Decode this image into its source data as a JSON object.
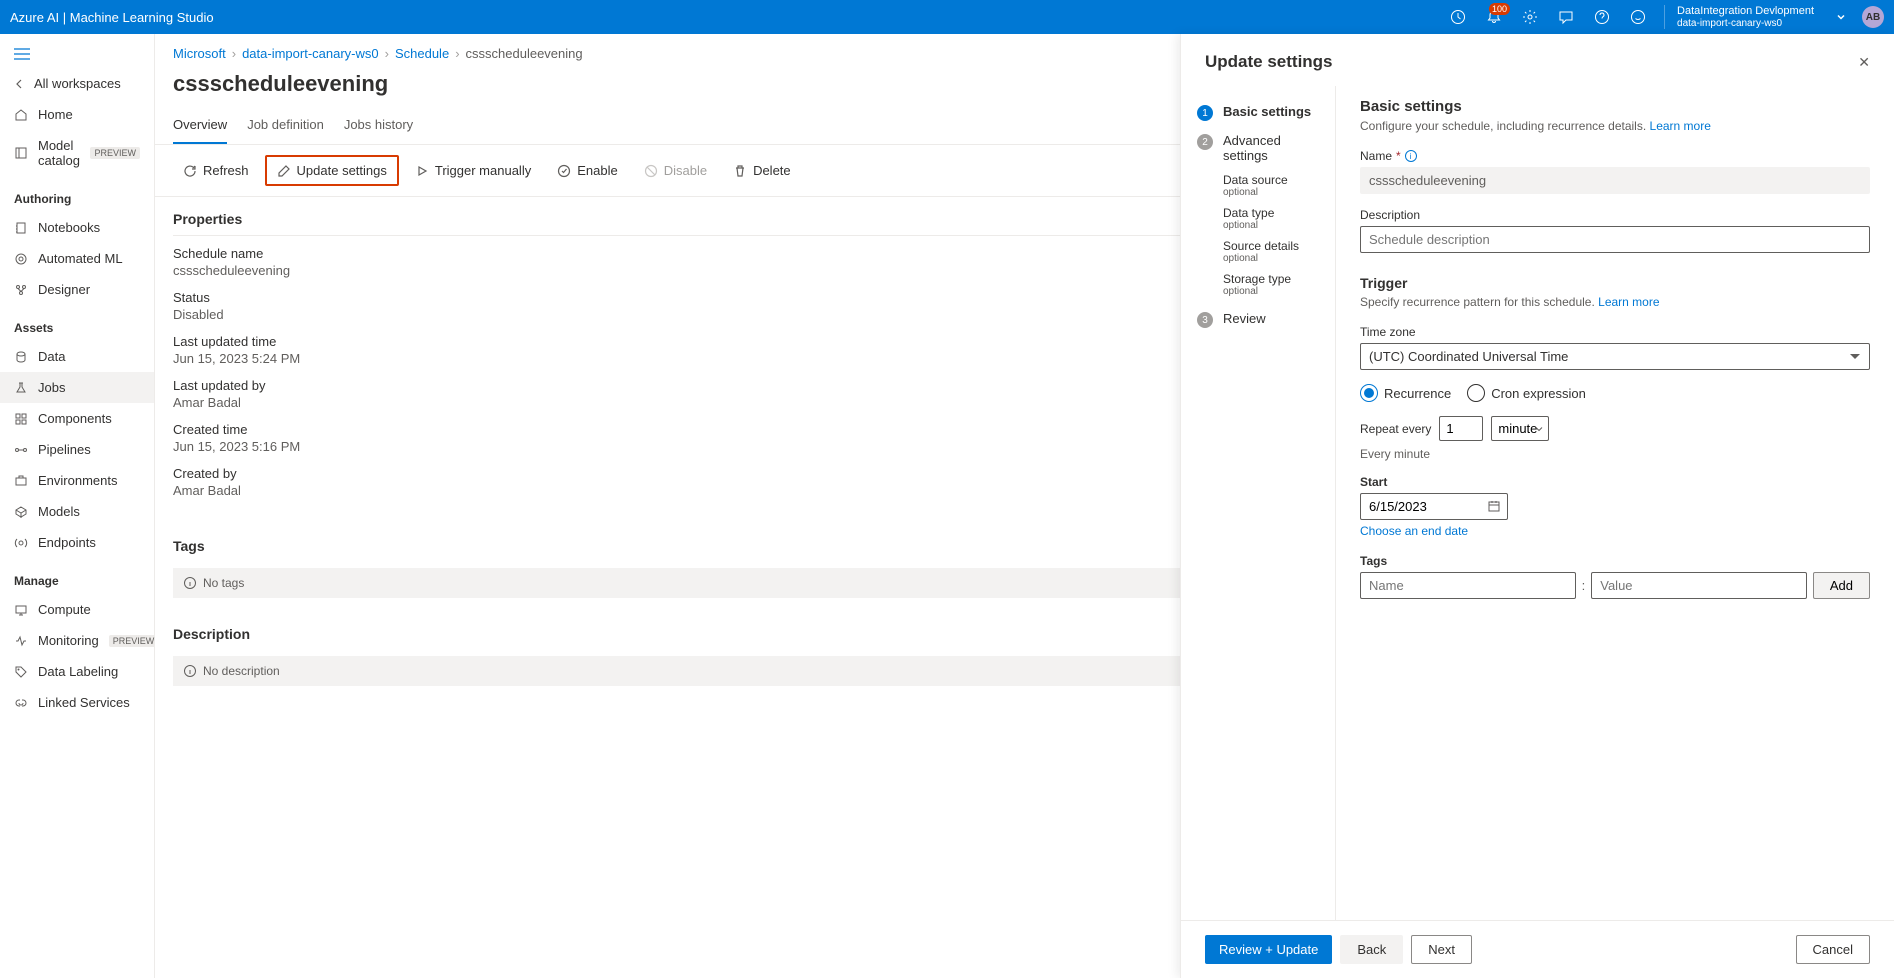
{
  "header": {
    "title": "Azure AI | Machine Learning Studio",
    "notification_count": "100",
    "account_name": "DataIntegration Devlopment",
    "account_ws": "data-import-canary-ws0",
    "avatar_initials": "AB"
  },
  "nav": {
    "back": "All workspaces",
    "items_top": [
      {
        "label": "Home",
        "icon": "home"
      },
      {
        "label": "Model catalog",
        "icon": "catalog",
        "preview": "PREVIEW"
      }
    ],
    "group_authoring": "Authoring",
    "items_authoring": [
      {
        "label": "Notebooks",
        "icon": "notebook"
      },
      {
        "label": "Automated ML",
        "icon": "automl"
      },
      {
        "label": "Designer",
        "icon": "designer"
      }
    ],
    "group_assets": "Assets",
    "items_assets": [
      {
        "label": "Data",
        "icon": "data"
      },
      {
        "label": "Jobs",
        "icon": "jobs",
        "active": true
      },
      {
        "label": "Components",
        "icon": "components"
      },
      {
        "label": "Pipelines",
        "icon": "pipelines"
      },
      {
        "label": "Environments",
        "icon": "environments"
      },
      {
        "label": "Models",
        "icon": "models"
      },
      {
        "label": "Endpoints",
        "icon": "endpoints"
      }
    ],
    "group_manage": "Manage",
    "items_manage": [
      {
        "label": "Compute",
        "icon": "compute"
      },
      {
        "label": "Monitoring",
        "icon": "monitoring",
        "preview": "PREVIEW"
      },
      {
        "label": "Data Labeling",
        "icon": "labeling"
      },
      {
        "label": "Linked Services",
        "icon": "linked"
      }
    ]
  },
  "breadcrumb": {
    "items": [
      "Microsoft",
      "data-import-canary-ws0",
      "Schedule",
      "cssscheduleevening"
    ]
  },
  "page": {
    "title": "cssscheduleevening",
    "tabs": [
      "Overview",
      "Job definition",
      "Jobs history"
    ],
    "actions": {
      "refresh": "Refresh",
      "update": "Update settings",
      "trigger": "Trigger manually",
      "enable": "Enable",
      "disable": "Disable",
      "delete": "Delete"
    }
  },
  "properties": {
    "title": "Properties",
    "rows": [
      {
        "label": "Schedule name",
        "value": "cssscheduleevening"
      },
      {
        "label": "Status",
        "value": "Disabled"
      },
      {
        "label": "Last updated time",
        "value": "Jun 15, 2023 5:24 PM"
      },
      {
        "label": "Last updated by",
        "value": "Amar Badal"
      },
      {
        "label": "Created time",
        "value": "Jun 15, 2023 5:16 PM"
      },
      {
        "label": "Created by",
        "value": "Amar Badal"
      }
    ],
    "tags_title": "Tags",
    "no_tags": "No tags",
    "desc_title": "Description",
    "no_desc": "No description"
  },
  "panel": {
    "title": "Update settings",
    "wizard": {
      "step1": "Basic settings",
      "step2": "Advanced settings",
      "step2_subs": [
        {
          "label": "Data source",
          "optional": "optional"
        },
        {
          "label": "Data type",
          "optional": "optional"
        },
        {
          "label": "Source details",
          "optional": "optional"
        },
        {
          "label": "Storage type",
          "optional": "optional"
        }
      ],
      "step3": "Review"
    },
    "form": {
      "section_title": "Basic settings",
      "section_desc": "Configure your schedule, including recurrence details.",
      "learn_more": "Learn more",
      "name_label": "Name",
      "name_value": "cssscheduleevening",
      "desc_label": "Description",
      "desc_placeholder": "Schedule description",
      "trigger_title": "Trigger",
      "trigger_desc": "Specify recurrence pattern for this schedule.",
      "tz_label": "Time zone",
      "tz_value": "(UTC) Coordinated Universal Time",
      "radio_recurrence": "Recurrence",
      "radio_cron": "Cron expression",
      "repeat_label": "Repeat every",
      "repeat_value": "1",
      "repeat_unit": "minute",
      "repeat_summary": "Every minute",
      "start_label": "Start",
      "start_value": "6/15/2023",
      "choose_end": "Choose an end date",
      "tags_label": "Tags",
      "tag_name_ph": "Name",
      "tag_value_ph": "Value",
      "add_label": "Add"
    },
    "footer": {
      "review_update": "Review + Update",
      "back": "Back",
      "next": "Next",
      "cancel": "Cancel"
    }
  }
}
